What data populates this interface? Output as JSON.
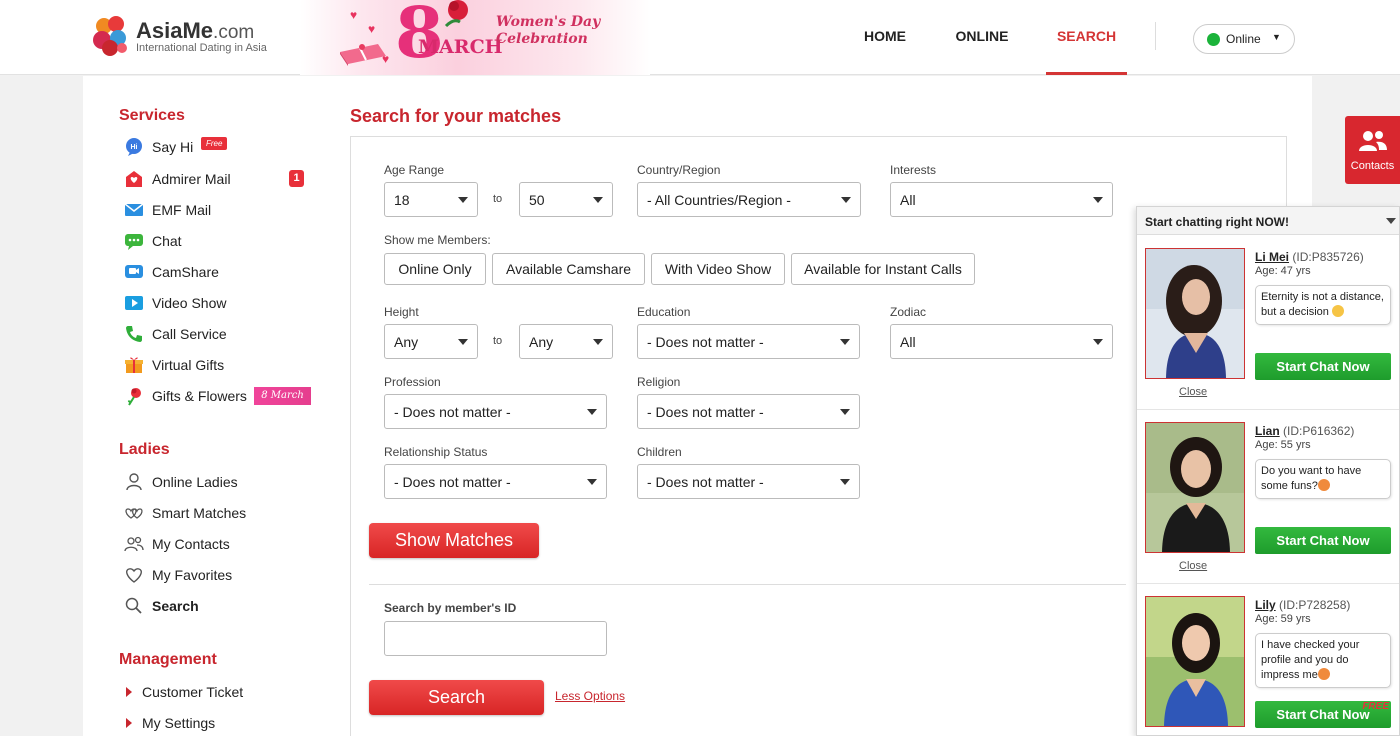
{
  "brand": {
    "name_main": "AsiaMe",
    "name_suffix": ".com",
    "tagline": "International Dating in Asia"
  },
  "banner": {
    "big_number": "8",
    "month": "MARCH",
    "title_line1": "Women's Day",
    "title_line2": "Celebration"
  },
  "nav": {
    "home": "HOME",
    "online": "ONLINE",
    "search": "SEARCH",
    "status": "Online"
  },
  "sidebar": {
    "services_heading": "Services",
    "services": [
      {
        "label": "Say Hi",
        "icon": "chat-hi-icon"
      },
      {
        "label": "Admirer Mail",
        "icon": "admirer-mail-icon"
      },
      {
        "label": "EMF Mail",
        "icon": "mail-icon"
      },
      {
        "label": "Chat",
        "icon": "chat-bubble-icon"
      },
      {
        "label": "CamShare",
        "icon": "camshare-icon"
      },
      {
        "label": "Video Show",
        "icon": "video-show-icon"
      },
      {
        "label": "Call Service",
        "icon": "phone-icon"
      },
      {
        "label": "Virtual Gifts",
        "icon": "gift-icon"
      },
      {
        "label": "Gifts & Flowers",
        "icon": "flower-icon"
      }
    ],
    "free_badge": "Free",
    "admirer_count": "1",
    "march_badge": "8 March",
    "ladies_heading": "Ladies",
    "ladies": [
      {
        "label": "Online Ladies",
        "icon": "person-icon"
      },
      {
        "label": "Smart Matches",
        "icon": "hearts-icon"
      },
      {
        "label": "My Contacts",
        "icon": "contacts-icon"
      },
      {
        "label": "My Favorites",
        "icon": "heart-icon"
      },
      {
        "label": "Search",
        "icon": "search-icon"
      }
    ],
    "management_heading": "Management",
    "management": [
      {
        "label": "Customer Ticket"
      },
      {
        "label": "My Settings"
      }
    ]
  },
  "search": {
    "title": "Search for your matches",
    "age_label": "Age Range",
    "age_from": "18",
    "to_label": "to",
    "age_to": "50",
    "country_label": "Country/Region",
    "country_value": "- All Countries/Region -",
    "interests_label": "Interests",
    "interests_value": "All",
    "show_members_label": "Show me Members:",
    "chips": [
      "Online Only",
      "Available Camshare",
      "With Video Show",
      "Available for Instant Calls"
    ],
    "height_label": "Height",
    "height_from": "Any",
    "height_to": "Any",
    "education_label": "Education",
    "education_value": "- Does not matter -",
    "zodiac_label": "Zodiac",
    "zodiac_value": "All",
    "profession_label": "Profession",
    "profession_value": "- Does not matter -",
    "religion_label": "Religion",
    "religion_value": "- Does not matter -",
    "relationship_label": "Relationship Status",
    "relationship_value": "- Does not matter -",
    "children_label": "Children",
    "children_value": "- Does not matter -",
    "show_matches_button": "Show Matches",
    "member_id_label": "Search by member's ID",
    "search_button": "Search",
    "less_options": "Less Options"
  },
  "contacts_tab": {
    "label": "Contacts"
  },
  "chat": {
    "heading": "Start chatting right NOW!",
    "cards": [
      {
        "name": "Li Mei",
        "id": "(ID:P835726)",
        "age": "Age: 47 yrs",
        "message": "Eternity is not a distance, but a decision ",
        "button": "Start Chat Now",
        "close": "Close"
      },
      {
        "name": "Lian",
        "id": "(ID:P616362)",
        "age": "Age: 55 yrs",
        "message": "Do you want to have some funs?",
        "button": "Start Chat Now",
        "close": "Close"
      },
      {
        "name": "Lily",
        "id": "(ID:P728258)",
        "age": "Age: 59 yrs",
        "message": "I have checked your profile and you do impress me",
        "button": "Start Chat Now",
        "free_tag": "FREE"
      }
    ]
  },
  "colors": {
    "brand_red": "#c8262e",
    "online_green": "#1bb33a",
    "chat_green": "#1e9c2c"
  }
}
